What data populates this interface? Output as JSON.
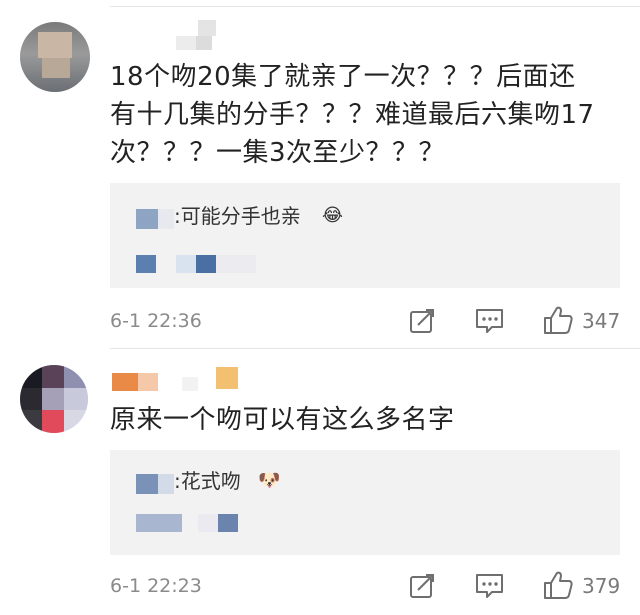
{
  "comments": [
    {
      "text": "18个吻20集了就亲了一次？？？后面还\n有十几集的分手？？？难道最后六集吻17\n次？？？一集3次至少？？？",
      "reply_text": ":可能分手也亲",
      "reply_emoji": "😂",
      "time": "6-1 22:36",
      "likes": "347"
    },
    {
      "text": "原来一个吻可以有这么多名字",
      "reply_text": ":花式吻",
      "reply_emoji": "🐶",
      "time": "6-1 22:23",
      "likes": "379"
    }
  ],
  "icons": {
    "repost": "repost-icon",
    "comment": "comment-icon",
    "like": "thumbs-up-icon"
  }
}
